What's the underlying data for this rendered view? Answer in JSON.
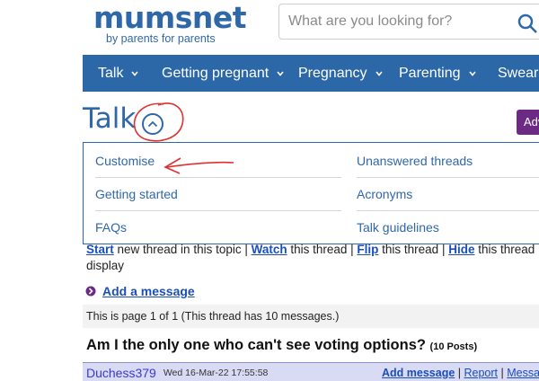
{
  "header": {
    "logo_text": "mumsnet",
    "tagline": "by parents for parents",
    "search_placeholder": "What are you looking for?"
  },
  "nav": {
    "items": [
      {
        "label": "Talk"
      },
      {
        "label": "Getting pregnant"
      },
      {
        "label": "Pregnancy"
      },
      {
        "label": "Parenting"
      },
      {
        "label": "Swears"
      }
    ]
  },
  "section": {
    "title": "Talk",
    "advert_button": "Adv"
  },
  "dropdown": {
    "left": [
      "Customise",
      "Getting started",
      "FAQs"
    ],
    "right": [
      "Unanswered threads",
      "Acronyms",
      "Talk guidelines"
    ]
  },
  "thread_links": {
    "start": "Start",
    "start_suffix": " new thread in this topic | ",
    "watch": "Watch",
    "watch_suffix": " this thread | ",
    "flip": "Flip",
    "flip_suffix": " this thread | ",
    "hide": "Hide",
    "hide_suffix": " this thread",
    "display": "display"
  },
  "add_message": "Add a message",
  "page_info": "This is page 1 of 1 (This thread has 10 messages.)",
  "thread": {
    "title": "Am I the only one who can't see voting options?",
    "post_count": "(10 Posts)"
  },
  "post": {
    "author": "Duchess379",
    "date": "Wed 16-Mar-22 17:55:58",
    "add_message": "Add message",
    "separator": " | ",
    "report": "Report",
    "message": "Message"
  },
  "colors": {
    "brand_blue": "#2f68a8",
    "nav_bg": "#2c68a8",
    "annotation_red": "#e03030",
    "advert_purple": "#6c2a85"
  }
}
